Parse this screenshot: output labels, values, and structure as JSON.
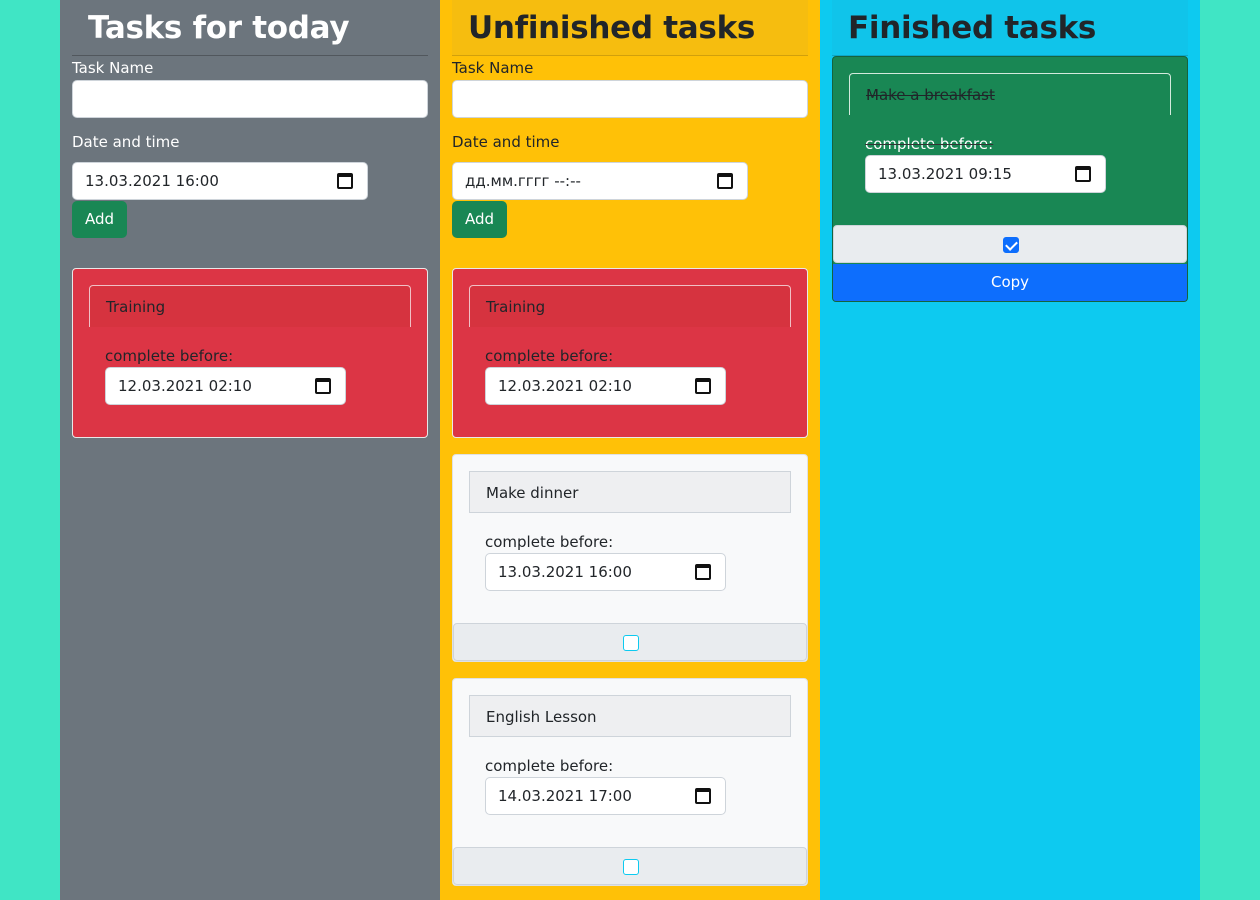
{
  "columns": {
    "today": {
      "title": "Tasks for today",
      "form": {
        "task_name_label": "Task Name",
        "task_name_value": "",
        "date_label": "Date and time",
        "date_value": "13.03.2021 16:00",
        "add_label": "Add"
      },
      "tasks": [
        {
          "title": "Training",
          "complete_label": "complete before:",
          "date": "12.03.2021 02:10",
          "status": "overdue"
        }
      ]
    },
    "unfinished": {
      "title": "Unfinished tasks",
      "form": {
        "task_name_label": "Task Name",
        "task_name_value": "",
        "date_label": "Date and time",
        "date_value": "дд.мм.гггг --:--",
        "add_label": "Add"
      },
      "tasks": [
        {
          "title": "Training",
          "complete_label": "complete before:",
          "date": "12.03.2021 02:10",
          "status": "overdue"
        },
        {
          "title": "Make dinner",
          "complete_label": "complete before:",
          "date": "13.03.2021 16:00",
          "status": "pending",
          "checked": false
        },
        {
          "title": "English Lesson",
          "complete_label": "complete before:",
          "date": "14.03.2021 17:00",
          "status": "pending",
          "checked": false
        }
      ]
    },
    "finished": {
      "title": "Finished tasks",
      "tasks": [
        {
          "title": "Make a breakfast",
          "complete_label": "complete before:",
          "date": "13.03.2021 09:15",
          "status": "done",
          "checked": true,
          "copy_label": "Copy"
        }
      ]
    }
  },
  "colors": {
    "page_bg": "#40e5c5",
    "today_bg": "#6c757d",
    "unfinished_bg": "#ffc107",
    "finished_bg": "#0dcaf0",
    "overdue_card": "#dc3545",
    "done_card": "#198754",
    "add_button": "#198754",
    "copy_button": "#0d6efd"
  },
  "icons": [
    "calendar-icon",
    "checkbox-icon"
  ]
}
